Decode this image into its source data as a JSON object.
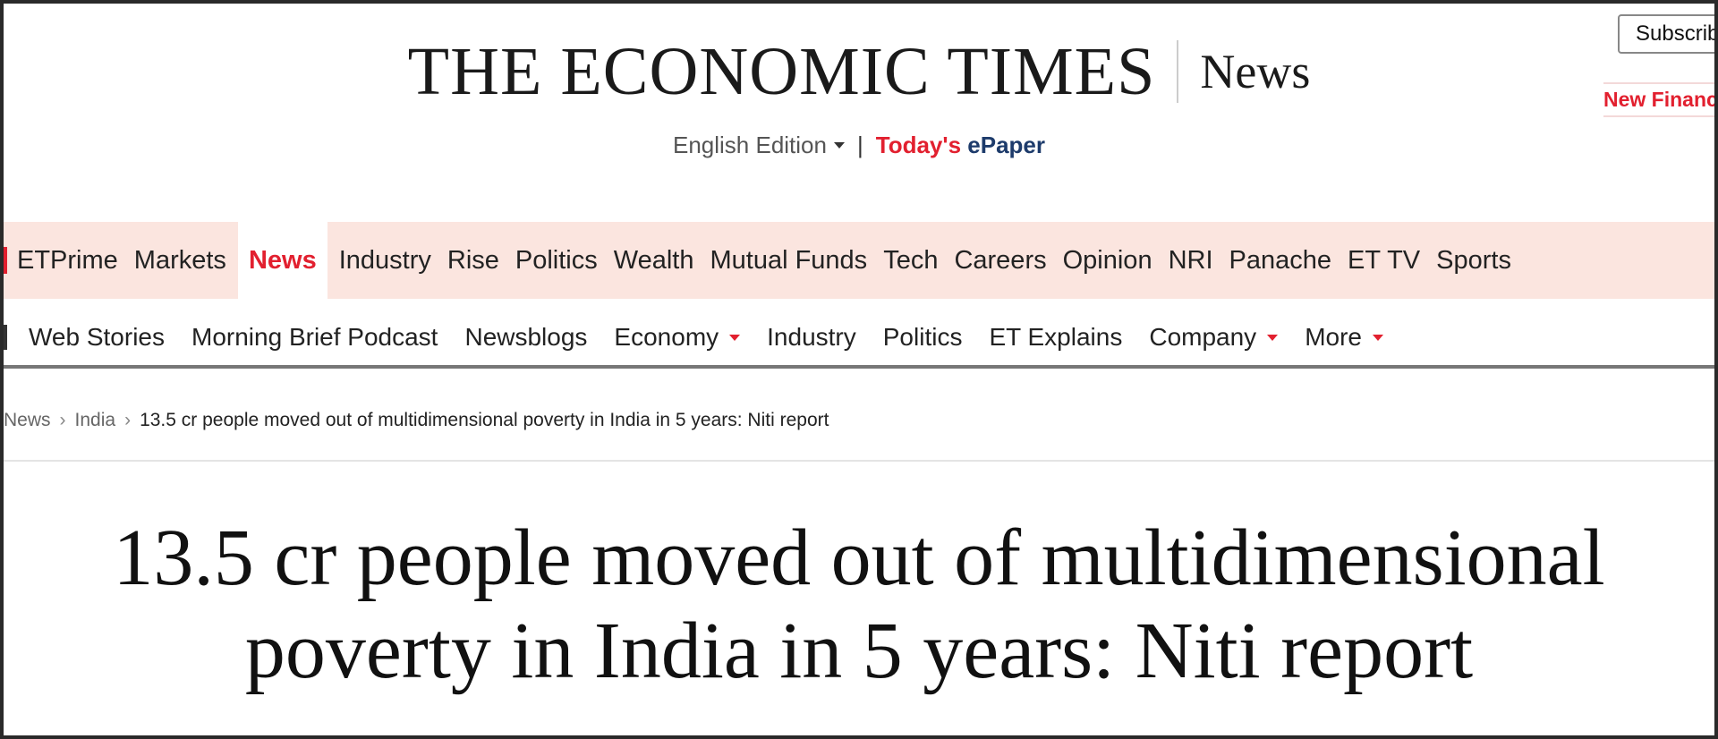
{
  "header": {
    "brand": "The Economic Times",
    "section": "News",
    "edition_label": "English Edition",
    "separator": "|",
    "epaper_part1": "Today's",
    "epaper_part2": "ePaper",
    "subscribe_label": "Subscribe",
    "promo_label": "New Financial Year"
  },
  "primary_nav": [
    {
      "label": "ETPrime"
    },
    {
      "label": "Markets"
    },
    {
      "label": "News",
      "active": true
    },
    {
      "label": "Industry"
    },
    {
      "label": "Rise"
    },
    {
      "label": "Politics"
    },
    {
      "label": "Wealth"
    },
    {
      "label": "Mutual Funds"
    },
    {
      "label": "Tech"
    },
    {
      "label": "Careers"
    },
    {
      "label": "Opinion"
    },
    {
      "label": "NRI"
    },
    {
      "label": "Panache"
    },
    {
      "label": "ET TV"
    },
    {
      "label": "Sports"
    }
  ],
  "secondary_nav": [
    {
      "label": "Web Stories"
    },
    {
      "label": "Morning Brief Podcast"
    },
    {
      "label": "Newsblogs"
    },
    {
      "label": "Economy",
      "dropdown": true
    },
    {
      "label": "Industry"
    },
    {
      "label": "Politics"
    },
    {
      "label": "ET Explains"
    },
    {
      "label": "Company",
      "dropdown": true
    },
    {
      "label": "More",
      "dropdown": true
    }
  ],
  "breadcrumb": {
    "items": [
      "News",
      "India"
    ],
    "separator": "›",
    "current": "13.5 cr people moved out of multidimensional poverty in India in 5 years: Niti report"
  },
  "article": {
    "headline_line1": "13.5 cr people moved out of multidimensional",
    "headline_line2": "poverty in India in 5 years: Niti report"
  },
  "colors": {
    "accent_red": "#e2202f",
    "nav_background": "#fbe5df",
    "epaper_navy": "#1d3b6b"
  },
  "icons": {
    "edition_caret": "caret-down-icon",
    "dropdown_caret": "red-caret-down-icon"
  }
}
